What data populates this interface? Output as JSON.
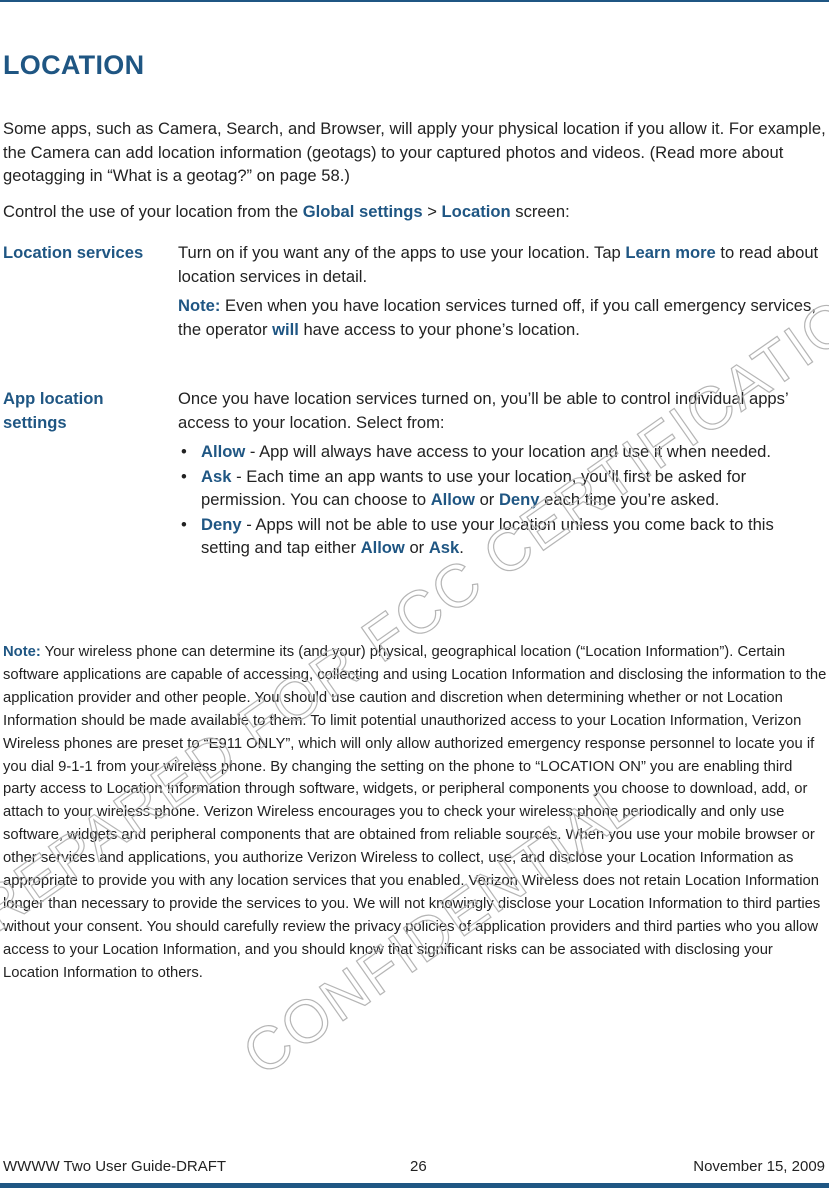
{
  "header": {
    "title": "LOCATION"
  },
  "intro": {
    "paragraph": "Some apps, such as Camera, Search, and Browser, will apply your physical location if you allow it. For example, the Camera can add location information (geotags) to your captured photos and videos. (Read more about geotagging in “What is a geotag?” on page 58.)",
    "control_prefix": "Control the use of your location from the ",
    "control_link1": "Global settings",
    "control_sep": " > ",
    "control_link2": "Location",
    "control_suffix": " screen:"
  },
  "settings": [
    {
      "term": "Location services",
      "desc_prefix": "Turn on if you want any of the apps to use your location. Tap ",
      "desc_link": "Learn more",
      "desc_suffix": " to read about location services in detail.",
      "note_label": "Note:",
      "note_prefix": " Even when you have location services turned off, if you call emergency services, the operator ",
      "note_emph": "will",
      "note_suffix": " have access to your phone’s location."
    },
    {
      "term": "App location settings",
      "desc": "Once you have location services turned on, you’ll be able to control individual apps’ access to your location. Select from:",
      "options": [
        {
          "label": "Allow",
          "text": " - App will always have access to your location and use it when needed."
        },
        {
          "label": "Ask",
          "text_prefix": " - Each time an app wants to use your location, you’ll first be asked for permission. You can choose to ",
          "emph1": "Allow",
          "text_mid": " or ",
          "emph2": "Deny",
          "text_suffix": " each time you’re asked."
        },
        {
          "label": "Deny",
          "text_prefix": " - Apps will not be able to use your location unless you come back to this setting and tap either ",
          "emph1": "Allow",
          "text_mid": " or ",
          "emph2": "Ask",
          "text_suffix": "."
        }
      ]
    }
  ],
  "legal_note": {
    "label": "Note:",
    "text": " Your wireless phone can determine its (and your) physical, geographical location (“Location Information”). Certain software applications are capable of accessing, collecting and using Location Information and disclosing the information to the application provider and other people. You should use caution and discretion when determining whether or not Location Information should be made available to them. To limit potential unauthorized access to your Location Information, Verizon Wireless phones are preset to “E911 ONLY”, which will only allow authorized emergency response personnel to locate you if you dial 9-1-1 from your wireless phone. By changing the setting on the phone to “LOCATION ON” you are enabling third party access to Location Information through software, widgets, or peripheral components you choose to download, add, or attach to your wireless phone. Verizon Wireless encourages you to check your wireless phone periodically and only use software, widgets and peripheral components that are obtained from reliable sources. When you use your mobile browser or other services and applications, you authorize Verizon Wireless to collect, use, and disclose your Location Information as appropriate to provide you with any location services that you enabled. Verizon Wireless does not retain Location Information longer than necessary to provide the services to you. We will not knowingly disclose your Location Information to third parties without your consent. You should carefully review the privacy policies of application providers and third parties who you allow access to your Location Information, and you should know that significant risks can be associated with disclosing your Location Information to others."
  },
  "footer": {
    "doc_title": "WWWW Two User Guide-DRAFT",
    "page_number": "26",
    "date": "November 15, 2009"
  },
  "watermark": {
    "line1": "PREPARED FOR FCC CERTIFICATION",
    "line2": "CONFIDENTIAL"
  },
  "colors": {
    "accent": "#1f5683",
    "text": "#222222",
    "watermark": "#b5b5b5"
  }
}
